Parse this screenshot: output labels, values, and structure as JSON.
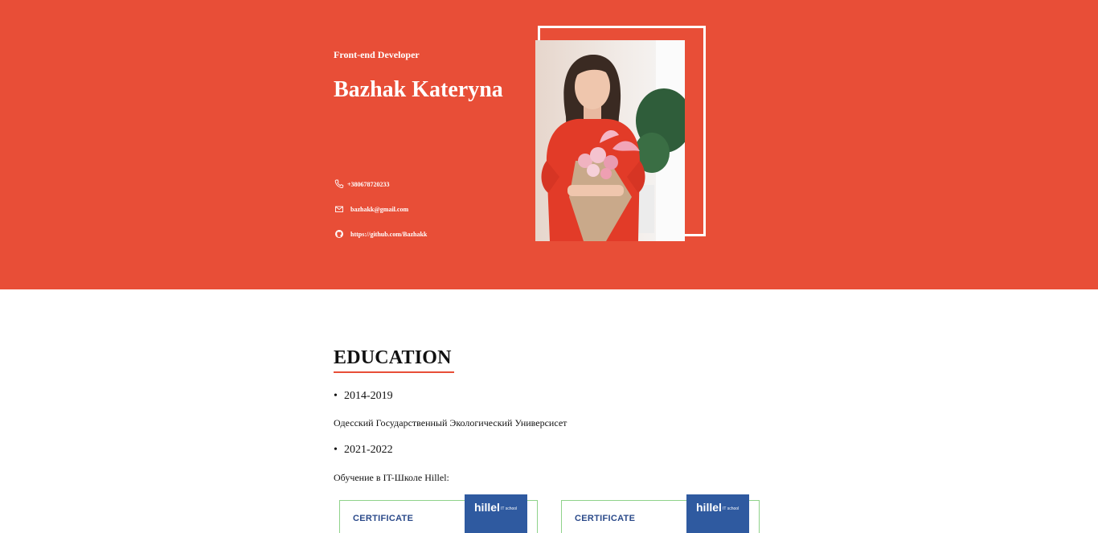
{
  "hero": {
    "role": "Front-end Developer",
    "name": "Bazhak Kateryna",
    "contacts": {
      "phone": "+380678720233",
      "email": "bazhakk@gmail.com",
      "github": "https://github.com/Bazhakk"
    }
  },
  "education": {
    "title": "EDUCATION",
    "entries": [
      {
        "years": "2014-2019",
        "description": "Одесский Государственный Экологический Универсисет"
      },
      {
        "years": "2021-2022",
        "description": "Обучение в IT-Школе Hillel:"
      }
    ],
    "certificates": [
      {
        "label": "CERTIFICATE",
        "logo": "hillel",
        "logo_sub": "IT school"
      },
      {
        "label": "CERTIFICATE",
        "logo": "hillel",
        "logo_sub": "IT school"
      }
    ]
  },
  "colors": {
    "accent": "#e84e37",
    "cert_border": "#8fd28a",
    "logo_bg": "#2f5aa0"
  },
  "icons": {
    "phone": "phone-icon",
    "email": "mail-icon",
    "github": "github-icon"
  }
}
